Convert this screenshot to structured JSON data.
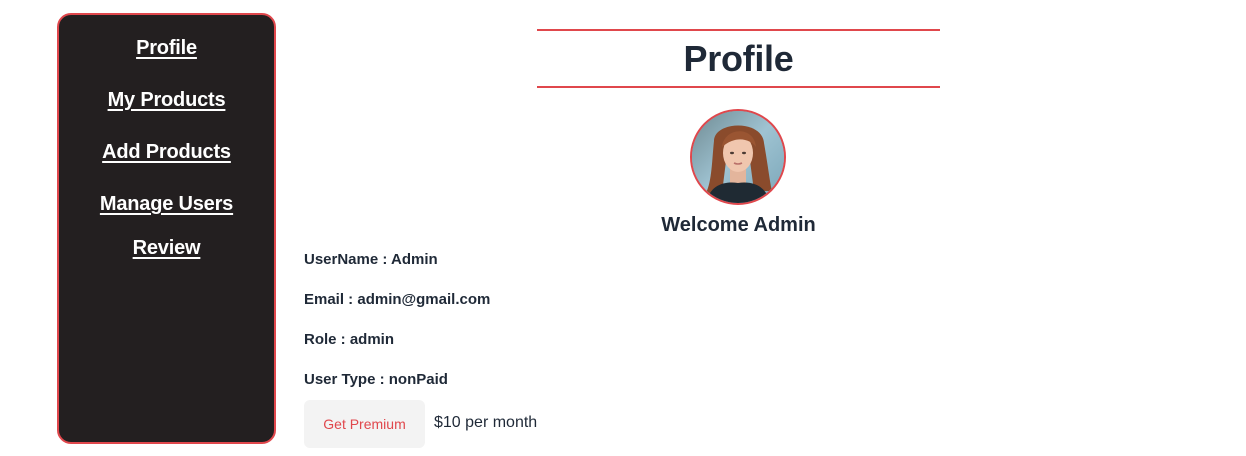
{
  "sidebar": {
    "items": [
      {
        "label": "Profile"
      },
      {
        "label": "My Products"
      },
      {
        "label": "Add Products"
      },
      {
        "label": "Manage Users"
      },
      {
        "label": "Review"
      }
    ]
  },
  "header": {
    "title": "Profile"
  },
  "profile": {
    "welcome": "Welcome Admin",
    "username_line": "UserName : Admin",
    "email_line": "Email : admin@gmail.com",
    "role_line": "Role : admin",
    "user_type_line": "User Type : nonPaid"
  },
  "premium": {
    "button_label": "Get Premium",
    "price_text": "$10 per month"
  },
  "colors": {
    "accent": "#e0474c",
    "sidebar_bg": "#231f20",
    "text": "#1f2937",
    "button_bg": "#f3f3f3"
  }
}
